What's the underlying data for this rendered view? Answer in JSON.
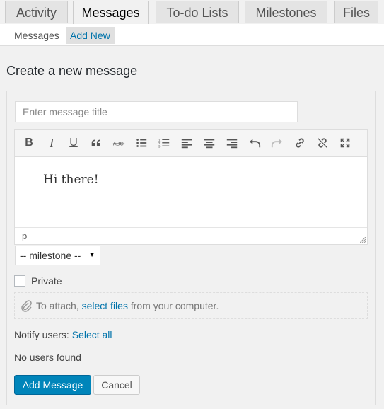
{
  "tabs": [
    {
      "label": "Activity"
    },
    {
      "label": "Messages"
    },
    {
      "label": "To-do Lists"
    },
    {
      "label": "Milestones"
    },
    {
      "label": "Files"
    }
  ],
  "subnav": {
    "messages": "Messages",
    "add_new": "Add New"
  },
  "page_title": "Create a new message",
  "form": {
    "title_placeholder": "Enter message title",
    "editor_content": "Hi there!",
    "editor_status": "p",
    "milestone_selected": "-- milestone --",
    "private_label": "Private",
    "attach_prefix": "To attach,",
    "attach_link": "select files",
    "attach_suffix": "from your computer.",
    "notify_label": "Notify users:",
    "select_all": "Select all",
    "no_users": "No users found",
    "submit_label": "Add Message",
    "cancel_label": "Cancel"
  },
  "toolbar_icons": [
    "bold-icon",
    "italic-icon",
    "underline-icon",
    "blockquote-icon",
    "strikethrough-icon",
    "bullet-list-icon",
    "numbered-list-icon",
    "align-left-icon",
    "align-center-icon",
    "align-right-icon",
    "undo-icon",
    "redo-icon",
    "link-icon",
    "unlink-icon",
    "fullscreen-icon"
  ],
  "colors": {
    "accent": "#0073aa",
    "primary_button": "#0085ba"
  }
}
